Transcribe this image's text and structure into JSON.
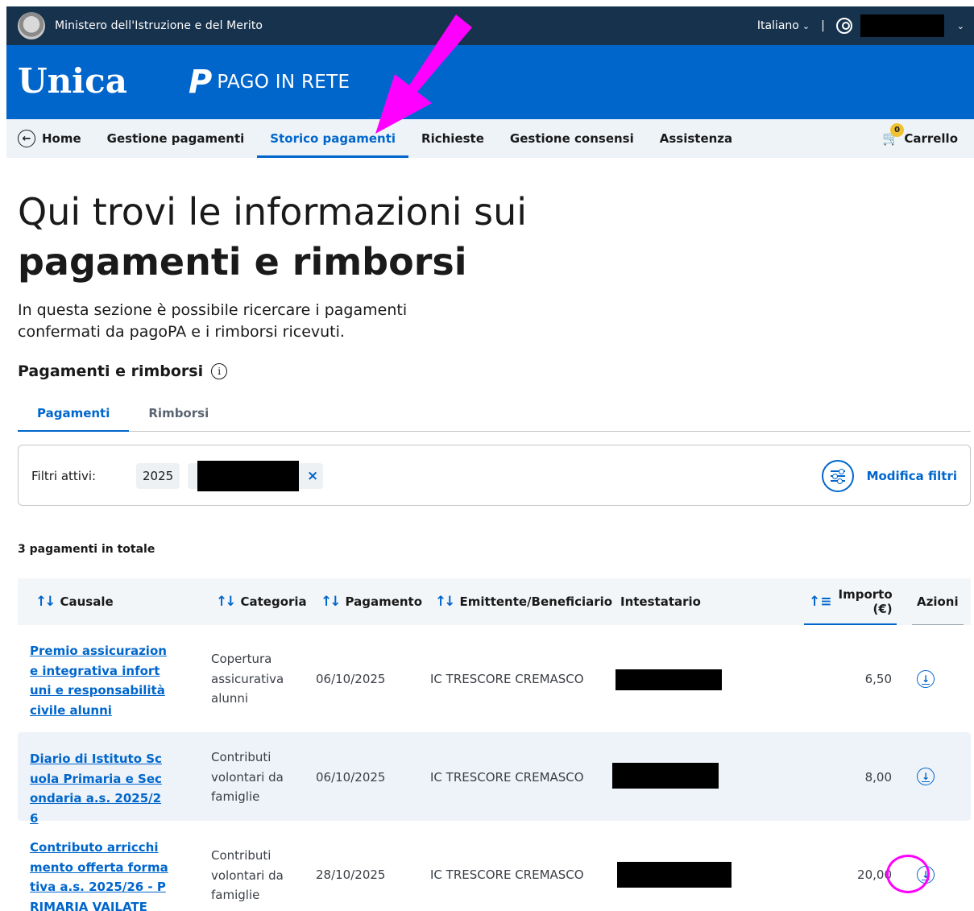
{
  "topbar": {
    "ministry": "Ministero dell'Istruzione e del Merito",
    "language": "Italiano",
    "separator": "|"
  },
  "header": {
    "logo": "Unica",
    "service": "PAGO IN RETE"
  },
  "nav": {
    "home": "Home",
    "items": [
      "Gestione pagamenti",
      "Storico pagamenti",
      "Richieste",
      "Gestione consensi",
      "Assistenza"
    ],
    "cart_label": "Carrello",
    "cart_count": "0"
  },
  "page": {
    "title_line1": "Qui trovi le informazioni sui",
    "title_line2": "pagamenti e rimborsi",
    "intro": "In questa sezione è possibile ricercare i pagamenti confermati da pagoPA e i rimborsi ricevuti.",
    "section_title": "Pagamenti e rimborsi"
  },
  "tabs": [
    "Pagamenti",
    "Rimborsi"
  ],
  "filters": {
    "label": "Filtri attivi:",
    "chip_year": "2025",
    "remove_symbol": "×",
    "edit_label": "Modifica filtri"
  },
  "table": {
    "total": "3 pagamenti in totale",
    "headers": {
      "causale": "Causale",
      "categoria": "Categoria",
      "pagamento": "Pagamento",
      "emittente": "Emittente/Beneficiario",
      "intestatario": "Intestatario",
      "importo": "Importo (€)",
      "azioni": "Azioni"
    },
    "rows": [
      {
        "causale": "Premio assicurazione integrativa infortuni e responsabilità civile alunni",
        "categoria": "Copertura assicurativa alunni",
        "pagamento": "06/10/2025",
        "emittente": "IC TRESCORE CREMASCO",
        "importo": "6,50"
      },
      {
        "causale": "Diario di Istituto Scuola Primaria e Secondaria a.s. 2025/26",
        "categoria": "Contributi volontari da famiglie",
        "pagamento": "06/10/2025",
        "emittente": "IC TRESCORE CREMASCO",
        "importo": "8,00"
      },
      {
        "causale": "Contributo arricchimento offerta formativa a.s. 2025/26 - PRIMARIA VAILATE",
        "categoria": "Contributi volontari da famiglie",
        "pagamento": "28/10/2025",
        "emittente": "IC TRESCORE CREMASCO",
        "importo": "20,00"
      }
    ]
  },
  "icons": {
    "emblem": "republic-emblem-icon",
    "user": "user-icon",
    "home": "arrow-left-circle-icon",
    "cart": "cart-icon",
    "info": "info-icon",
    "filter": "filter-sliders-icon",
    "download": "download-icon",
    "sort": "sort-arrows-icon"
  },
  "colors": {
    "topbar": "#17324d",
    "brand_blue": "#0066cc",
    "annotation": "#ff00ff",
    "badge": "#f0c22f"
  }
}
